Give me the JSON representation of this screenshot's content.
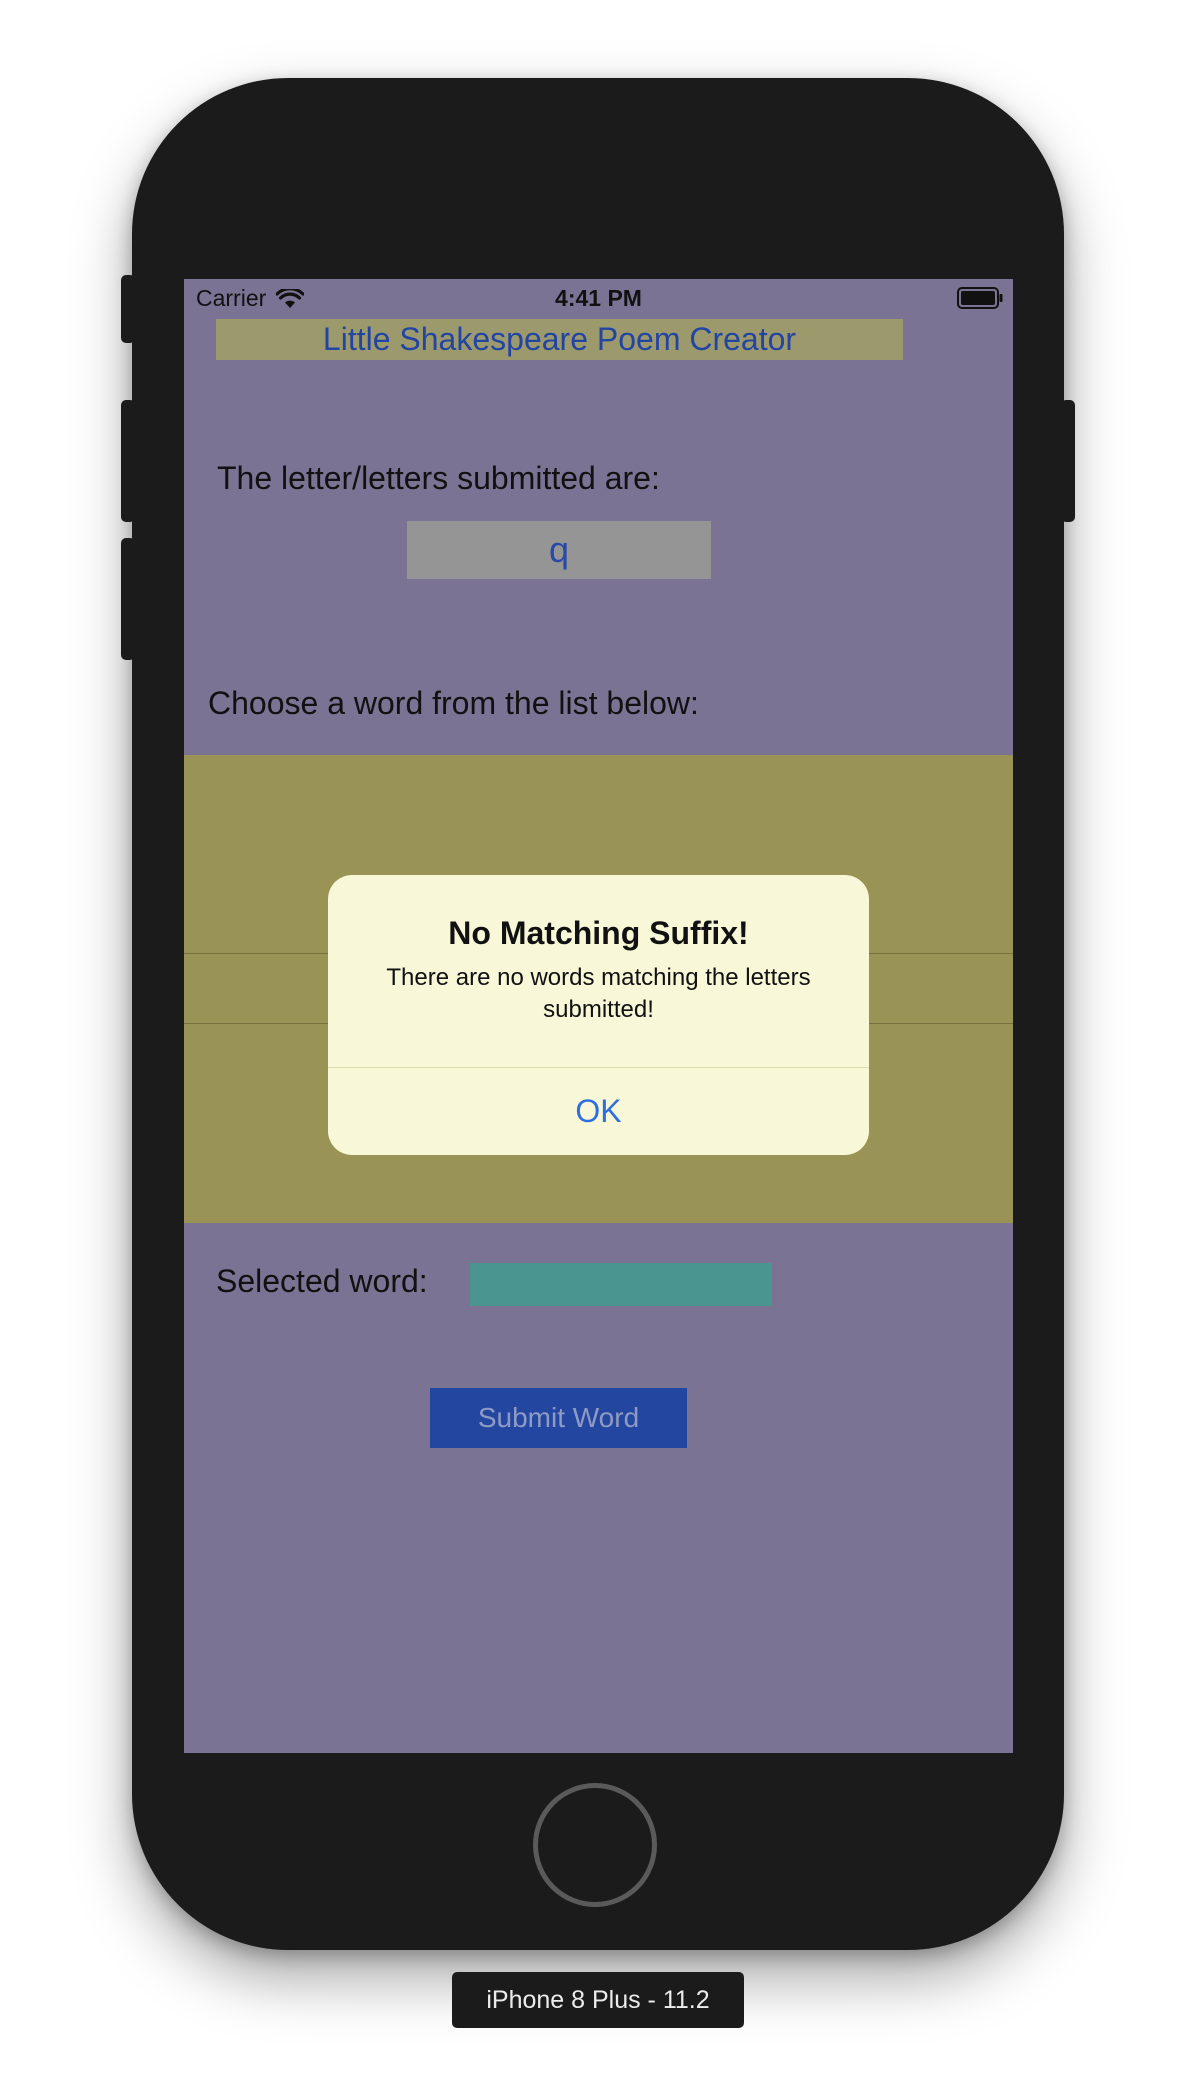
{
  "status_bar": {
    "carrier": "Carrier",
    "time": "4:41 PM",
    "wifi_icon": "wifi-icon",
    "battery_icon": "battery-icon"
  },
  "app": {
    "title": "Little Shakespeare Poem Creator",
    "letters_label": "The letter/letters submitted are:",
    "letters_value": "q",
    "choose_label": "Choose a word from the list below:",
    "selected_word_label": "Selected word:",
    "selected_word_value": "",
    "submit_button": "Submit Word"
  },
  "alert": {
    "title": "No Matching Suffix!",
    "message": "There are no words matching the letters submitted!",
    "ok_button": "OK"
  },
  "simulator": {
    "device_label": "iPhone 8 Plus - 11.2"
  },
  "colors": {
    "screen_background": "#7b7394",
    "title_banner": "#9c9a6c",
    "picker_background": "#999455",
    "selected_field": "#4a958f",
    "submit_button": "#2347a1",
    "alert_background": "#f8f7d8",
    "accent_blue": "#2e6fe0",
    "device_body": "#1b1b1b"
  }
}
